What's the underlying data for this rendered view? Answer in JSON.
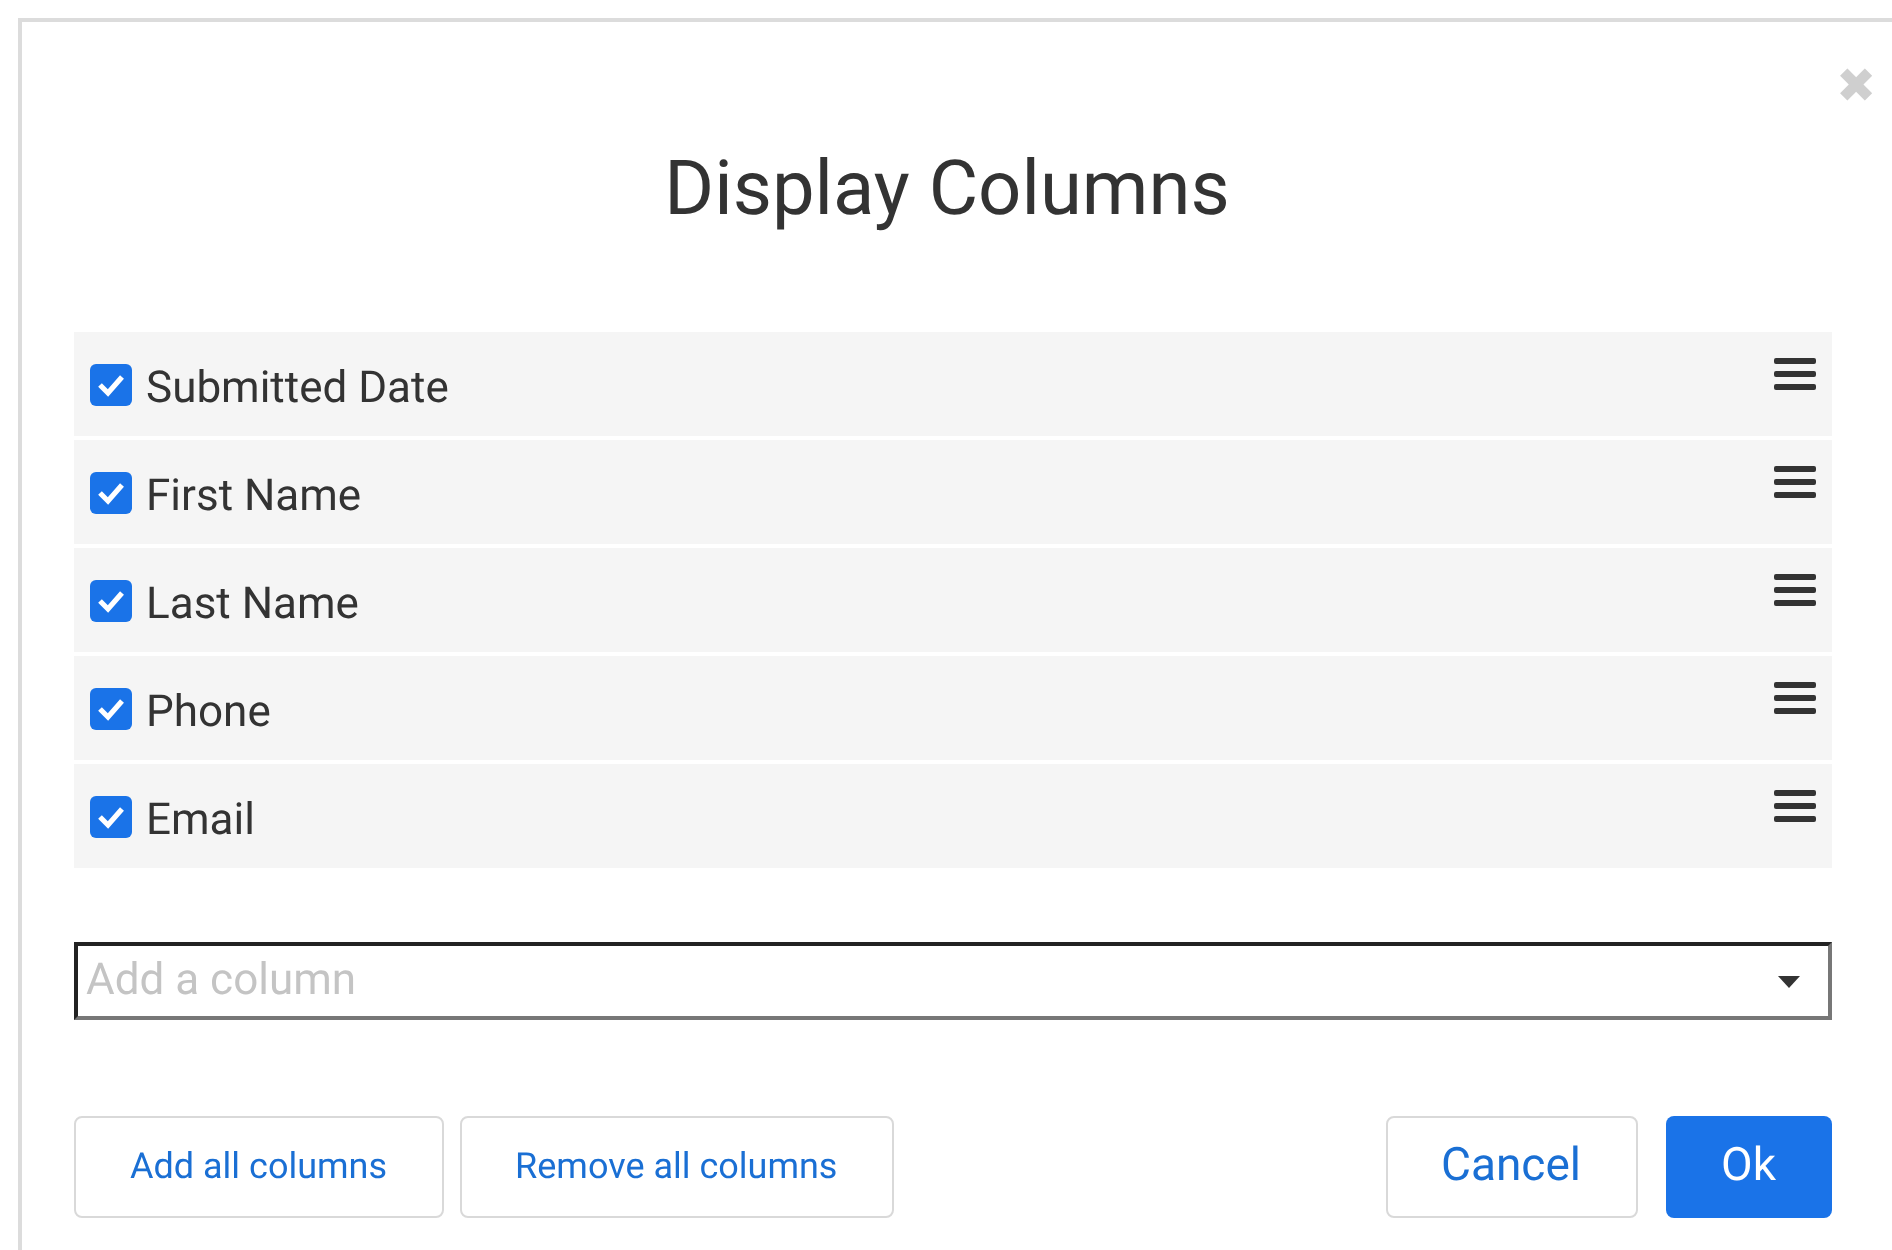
{
  "dialog": {
    "title": "Display Columns",
    "close_label": "✖"
  },
  "columns": [
    {
      "label": "Submitted Date",
      "checked": true
    },
    {
      "label": "First Name",
      "checked": true
    },
    {
      "label": "Last Name",
      "checked": true
    },
    {
      "label": "Phone",
      "checked": true
    },
    {
      "label": "Email",
      "checked": true
    }
  ],
  "add_column": {
    "placeholder": "Add a column"
  },
  "buttons": [
    {
      "label": "Add all columns",
      "kind": "secondary"
    },
    {
      "label": "Remove all columns",
      "kind": "secondary"
    },
    {
      "label": "Cancel",
      "kind": "cancel"
    },
    {
      "label": "Ok",
      "kind": "primary"
    }
  ]
}
